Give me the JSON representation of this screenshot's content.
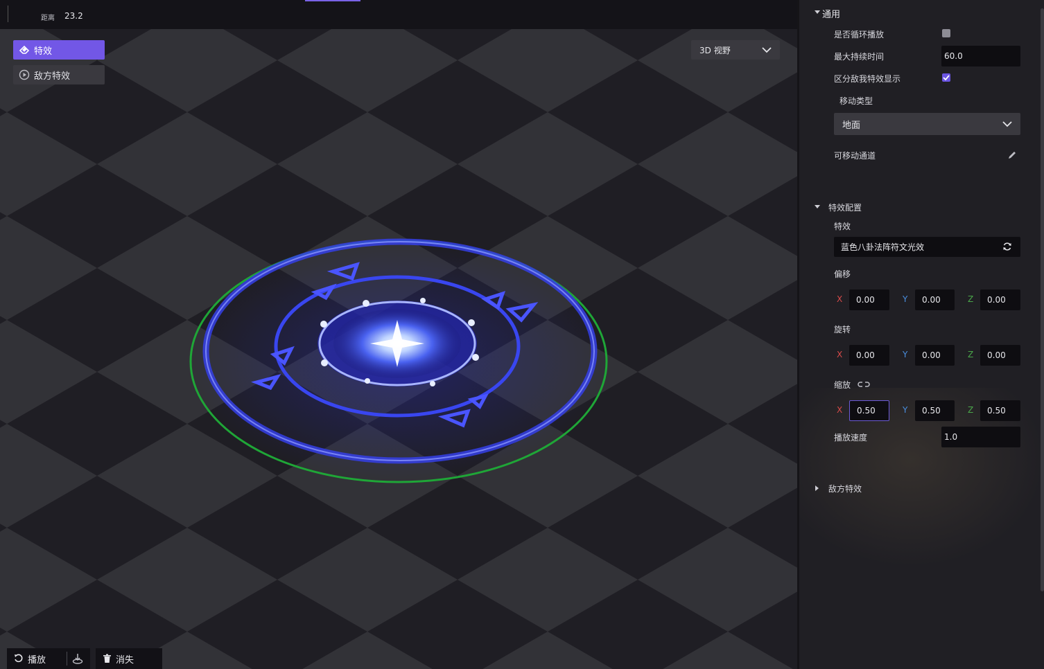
{
  "topbar": {
    "distance_label": "距离",
    "distance_value": "23.2"
  },
  "viewport": {
    "effect_button": "特效",
    "enemy_effect_button": "敌方特效",
    "view_mode": "3D 视野"
  },
  "bottombar": {
    "play_label": "播放",
    "vanish_label": "消失"
  },
  "panel": {
    "general": {
      "title": "通用",
      "loop_label": "是否循环播放",
      "loop_checked": false,
      "max_duration_label": "最大持续时间",
      "max_duration_value": "60.0",
      "distinguish_label": "区分敌我特效显示",
      "distinguish_checked": true,
      "move_type_label": "移动类型",
      "move_type_value": "地面",
      "movable_channel_label": "可移动通道"
    },
    "effect_config": {
      "title": "特效配置",
      "effect_label": "特效",
      "effect_value": "蓝色八卦法阵符文光效",
      "offset_label": "偏移",
      "offset": {
        "x": "0.00",
        "y": "0.00",
        "z": "0.00"
      },
      "rotation_label": "旋转",
      "rotation": {
        "x": "0.00",
        "y": "0.00",
        "z": "0.00"
      },
      "scale_label": "缩放",
      "scale": {
        "x": "0.50",
        "y": "0.50",
        "z": "0.50"
      },
      "speed_label": "播放速度",
      "speed_value": "1.0",
      "axis_x": "X",
      "axis_y": "Y",
      "axis_z": "Z"
    },
    "enemy_effect": {
      "title": "敌方特效"
    }
  },
  "colors": {
    "accent": "#7257e6",
    "axis_x": "#d84a4a",
    "axis_y": "#4a8fe0",
    "axis_z": "#4aa84a",
    "ring_green": "#1fa637",
    "magic_blue": "#3b3ce8"
  }
}
